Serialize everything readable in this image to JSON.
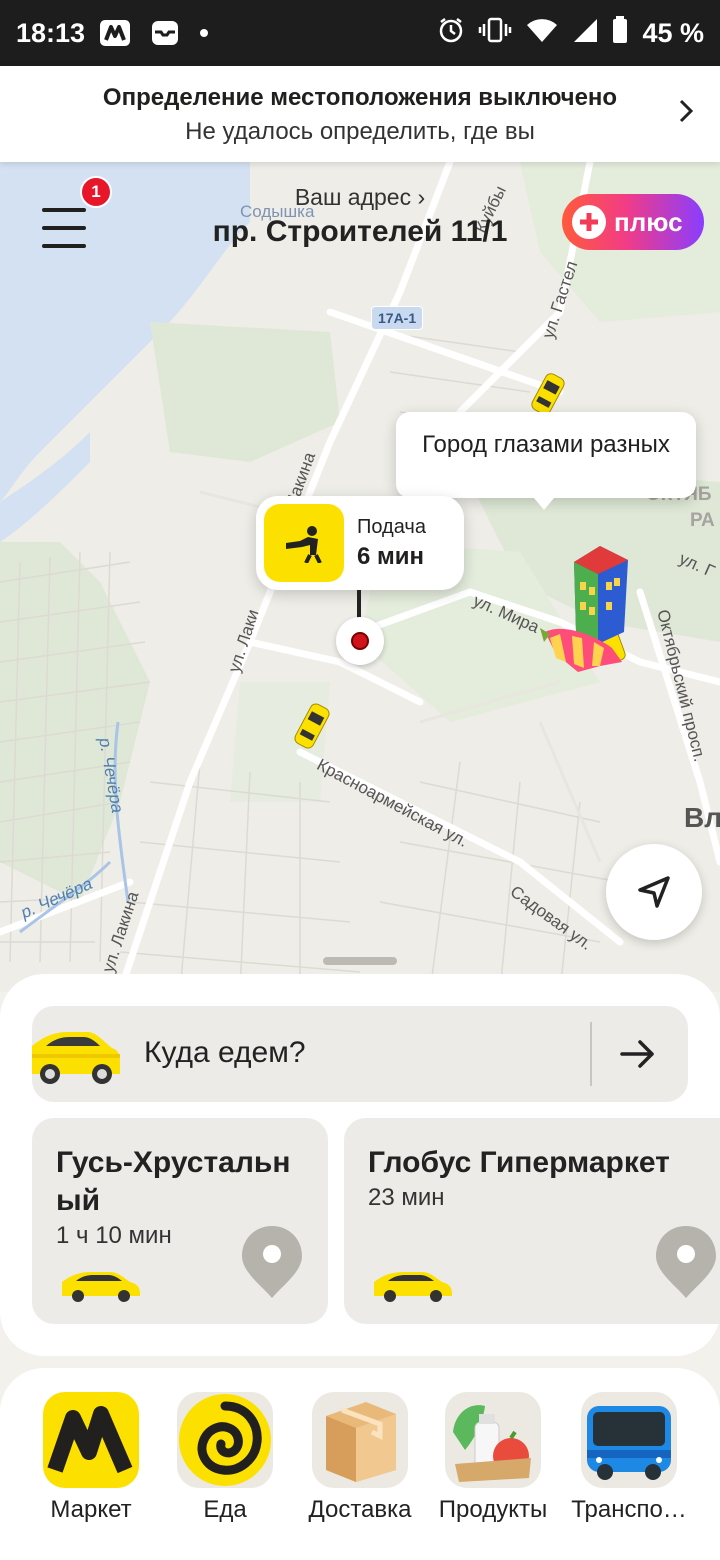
{
  "status_bar": {
    "time": "18:13",
    "battery_text": "45 %"
  },
  "location_banner": {
    "title": "Определение местоположения выключено",
    "subtitle": "Не удалось определить, где вы"
  },
  "header": {
    "menu_badge": "1",
    "address_caption": "Ваш адрес",
    "address": "пр. Строителей 11/1",
    "plus_label": "плюс"
  },
  "map": {
    "road_badge": "17А-1",
    "labels": {
      "sodyshka": "Содышка",
      "lakina_top": "ул. Лакина",
      "lakina_mid": "ул. Лаки",
      "lakina_bottom": "ул. Лакина",
      "mira": "ул. Мира",
      "krasnoarmeyskaya": "Красноармейская ул.",
      "sadovaya": "Садовая ул.",
      "oktyabrsky": "Октябрьский просп.",
      "chechera_1": "р. Чечёра",
      "chechera_2": "р. Чечёра",
      "gastello": "ул. Гастел",
      "kuyby": "Куйбы",
      "oktyab_1": "ОКТЯБ",
      "oktyab_2": "РА",
      "ul_g": "ул. Г",
      "vl": "Вл"
    },
    "callout": "Город глазами разных",
    "pickup": {
      "label": "Подача",
      "time": "6 мин"
    }
  },
  "search": {
    "placeholder": "Куда едем?"
  },
  "destinations": [
    {
      "name": "Гусь-Хрустальн\nый",
      "time": "1 ч 10 мин"
    },
    {
      "name": "Глобус Гипермаркет",
      "time": "23 мин"
    }
  ],
  "services": [
    {
      "label": "Маркет"
    },
    {
      "label": "Еда"
    },
    {
      "label": "Доставка"
    },
    {
      "label": "Продукты"
    },
    {
      "label": "Транспо…"
    }
  ],
  "colors": {
    "accent_yellow": "#fce000",
    "badge_red": "#e8162a",
    "plus_gradient_start": "#ff5a3c",
    "plus_gradient_end": "#8a3dff"
  }
}
